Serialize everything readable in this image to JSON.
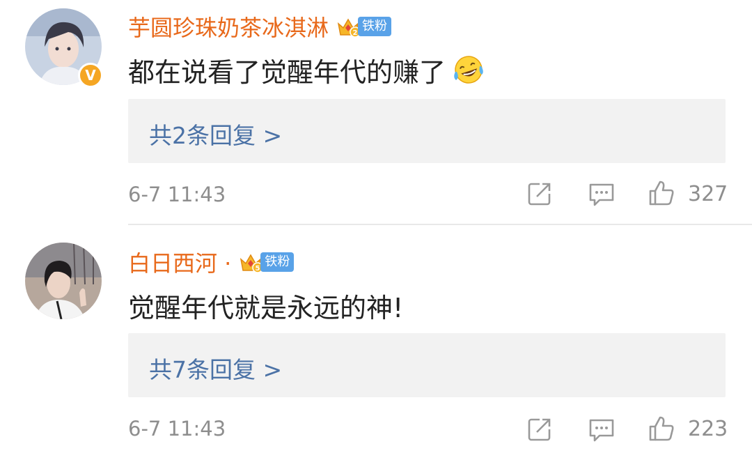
{
  "comments": [
    {
      "username": "芋圆珍珠奶茶冰淇淋",
      "verified_badge": "V",
      "fan_badge": {
        "level": "2",
        "label": "铁粉",
        "icon": "crown-badge-icon"
      },
      "text": "都在说看了觉醒年代的赚了",
      "emoji": "laughing-crying-emoji",
      "replies_link": "共2条回复 >",
      "timestamp": "6-7 11:43",
      "likes": "327"
    },
    {
      "username": "白日西河 ·",
      "fan_badge": {
        "level": "5",
        "label": "铁粉",
        "icon": "crown-badge-icon"
      },
      "text": "觉醒年代就是永远的神!",
      "replies_link": "共7条回复 >",
      "timestamp": "6-7 11:43",
      "likes": "223"
    }
  ],
  "colors": {
    "username": "#e8691b",
    "reply_link": "#4b72a6",
    "fan_badge": "#59a2e8",
    "meta": "#8e8e8e"
  },
  "icons": [
    "share-icon",
    "comment-icon",
    "thumbs-up-icon"
  ]
}
